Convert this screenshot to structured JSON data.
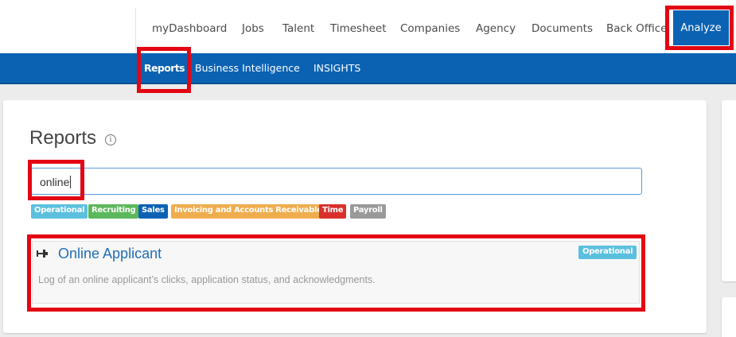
{
  "nav": {
    "items": [
      "myDashboard",
      "Jobs",
      "Talent",
      "Timesheet",
      "Companies",
      "Agency",
      "Documents",
      "Back Office"
    ],
    "active": "Analyze"
  },
  "subnav": {
    "items": [
      "Reports",
      "Business Intelligence",
      "INSIGHTS"
    ]
  },
  "page": {
    "title": "Reports",
    "info_icon": "i"
  },
  "search": {
    "value": "online"
  },
  "filters": [
    {
      "label": "Operational",
      "color": "#5bc0de"
    },
    {
      "label": "Recruiting",
      "color": "#5cb85c"
    },
    {
      "label": "Sales",
      "color": "#0b62b3"
    },
    {
      "label": "Invoicing and Accounts Receivable",
      "color": "#f0ad4e"
    },
    {
      "label": "Time",
      "color": "#d9302c"
    },
    {
      "label": "Payroll",
      "color": "#999999"
    }
  ],
  "result": {
    "title": "Online Applicant",
    "description": "Log of an online applicant’s clicks, application status, and acknowledgments.",
    "tag": "Operational",
    "icon": "pin-icon"
  },
  "colors": {
    "brand_blue": "#0b62b3",
    "highlight_red": "#e30613"
  }
}
